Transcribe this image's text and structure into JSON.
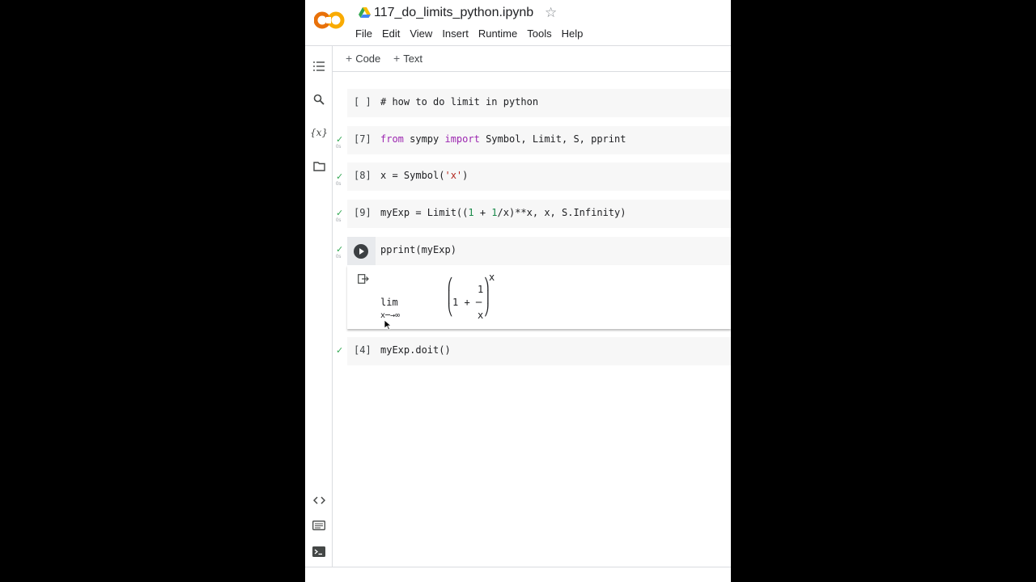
{
  "app": {
    "logo_text": "CO",
    "brand_orange": "#f9ab00",
    "brand_dark_orange": "#e8710a"
  },
  "header": {
    "title": "117_do_limits_python.ipynb",
    "star_icon": "star-icon"
  },
  "menu": [
    "File",
    "Edit",
    "View",
    "Insert",
    "Runtime",
    "Tools",
    "Help"
  ],
  "toolbar": {
    "add_code": "Code",
    "add_text": "Text"
  },
  "rail": [
    "toc-icon",
    "search-icon",
    "variables-icon",
    "folder-icon",
    "code-snippets-icon",
    "command-palette-icon",
    "terminal-icon"
  ],
  "cells": [
    {
      "exec": "[ ]",
      "code": "# how to do limit in python",
      "status": ""
    },
    {
      "exec": "[7]",
      "status": "0s"
    },
    {
      "exec": "[8]",
      "status": "0s"
    },
    {
      "exec": "[9]",
      "status": "0s"
    },
    {
      "exec": "",
      "code": "pprint(myExp)",
      "status": "0s"
    },
    {
      "exec": "[4]",
      "code": "myExp.doit()",
      "status": ""
    }
  ],
  "code_tokens": {
    "c7_from": "from",
    "c7_mid": " sympy ",
    "c7_import": "import",
    "c7_rest": " Symbol, Limit, S, pprint",
    "c8_a": "x = Symbol(",
    "c8_str": "'x'",
    "c8_b": ")",
    "c9_a": "myExp = Limit((",
    "c9_n1": "1",
    "c9_b": " + ",
    "c9_n2": "1",
    "c9_c": "/x)**x, x, S.Infinity)"
  },
  "output": {
    "exp_x": "x",
    "numerator": "1",
    "lim": "lim",
    "middle": "1 + ─",
    "denominator": "x",
    "sub": "x─→∞",
    "left_paren": "⎛\n⎜\n⎝",
    "right_paren": "⎞\n⎟\n⎠"
  }
}
